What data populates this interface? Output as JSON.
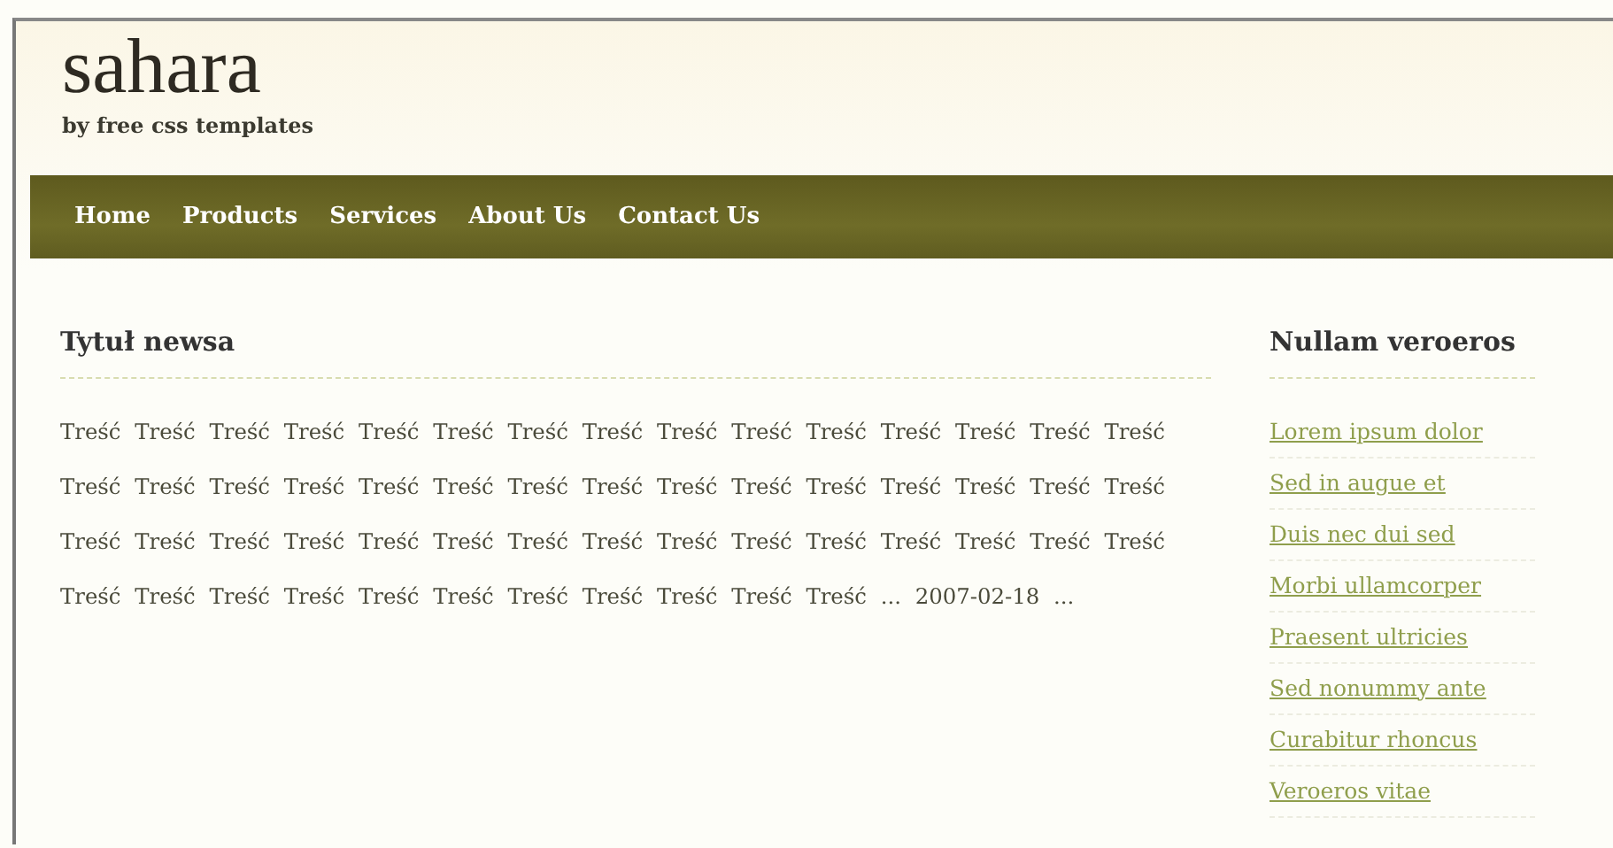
{
  "header": {
    "title": "sahara",
    "subtitle": "by free css templates"
  },
  "nav": [
    {
      "label": "Home"
    },
    {
      "label": "Products"
    },
    {
      "label": "Services"
    },
    {
      "label": "About Us"
    },
    {
      "label": "Contact Us"
    }
  ],
  "post": {
    "title": "Tytuł newsa",
    "body": "Treść Treść Treść Treść Treść Treść Treść Treść Treść Treść Treść Treść Treść Treść Treść Treść Treść Treść Treść Treść Treść Treść Treść Treść Treść Treść Treść Treść Treść Treść Treść Treść Treść Treść Treść Treść Treść Treść Treść Treść Treść Treść Treść Treść Treść Treść Treść Treść Treść Treść Treść Treść Treść Treść Treść Treść ... 2007-02-18 ..."
  },
  "sidebar": {
    "title": "Nullam veroeros",
    "links": [
      "Lorem ipsum dolor",
      "Sed in augue et",
      "Duis nec dui sed",
      "Morbi ullamcorper",
      "Praesent ultricies",
      "Sed nonummy ante",
      "Curabitur rhoncus",
      "Veroeros vitae"
    ]
  }
}
